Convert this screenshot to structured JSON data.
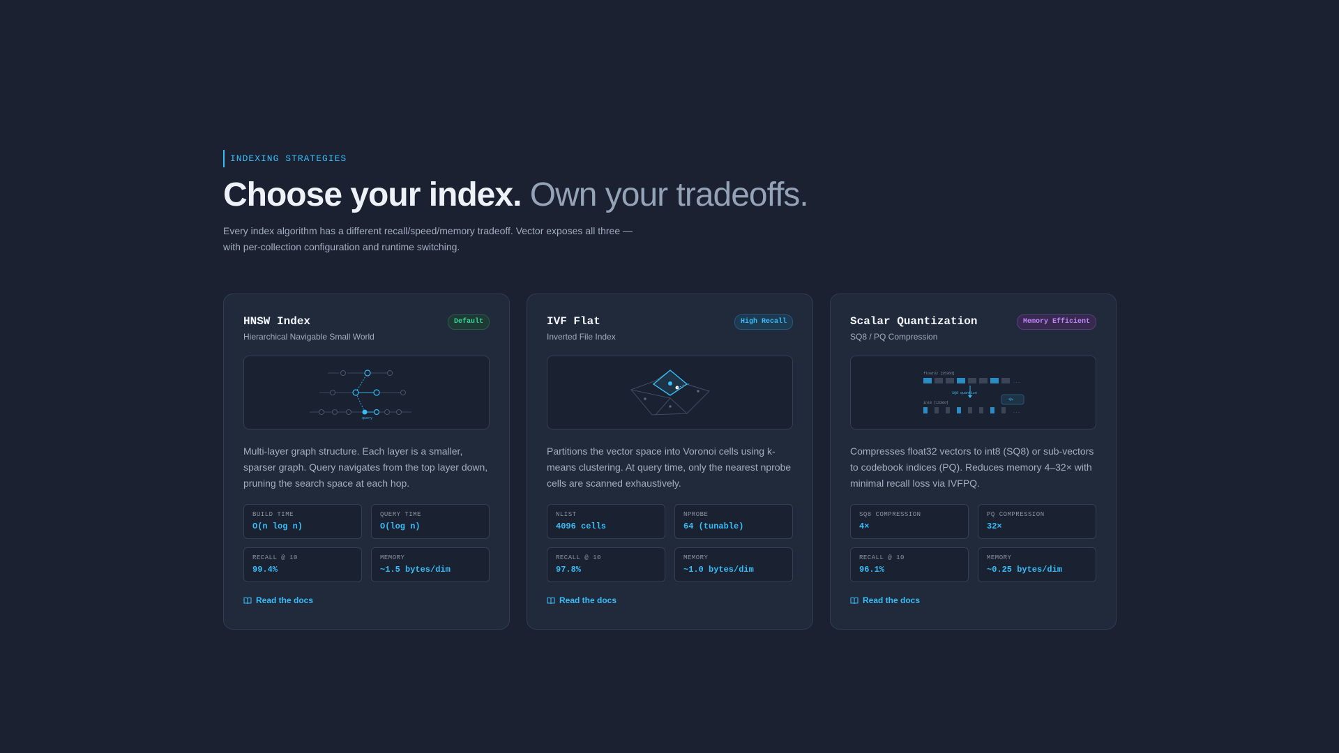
{
  "section": {
    "eyebrow": "INDEXING STRATEGIES",
    "headline_strong": "Choose your index.",
    "headline_soft": "Own your tradeoffs.",
    "lede": "Every index algorithm has a different recall/speed/memory tradeoff. Vector exposes all three — with per-collection configuration and runtime switching."
  },
  "colors": {
    "background": "#1b2131",
    "card": "#212a3b",
    "accent": "#38bdf8",
    "badge_default": "#34d399",
    "badge_high_recall": "#38bdf8",
    "badge_memory": "#c084fc"
  },
  "cards": [
    {
      "title": "HNSW Index",
      "badge": "Default",
      "subtitle": "Hierarchical Navigable Small World",
      "viz_label": "query",
      "description": "Multi-layer graph structure. Each layer is a smaller, sparser graph. Query navigates from the top layer down, pruning the search space at each hop.",
      "stats": [
        {
          "label": "BUILD TIME",
          "value": "O(n log n)"
        },
        {
          "label": "QUERY TIME",
          "value": "O(log n)"
        },
        {
          "label": "RECALL @ 10",
          "value": "99.4%"
        },
        {
          "label": "MEMORY",
          "value": "~1.5 bytes/dim"
        }
      ],
      "docs_label": "Read the docs",
      "docs_icon": "book-icon"
    },
    {
      "title": "IVF Flat",
      "badge": "High Recall",
      "subtitle": "Inverted File Index",
      "description": "Partitions the vector space into Voronoi cells using k-means clustering. At query time, only the nearest nprobe cells are scanned exhaustively.",
      "stats": [
        {
          "label": "NLIST",
          "value": "4096 cells"
        },
        {
          "label": "NPROBE",
          "value": "64 (tunable)"
        },
        {
          "label": "RECALL @ 10",
          "value": "97.8%"
        },
        {
          "label": "MEMORY",
          "value": "~1.0 bytes/dim"
        }
      ],
      "docs_label": "Read the docs",
      "docs_icon": "book-icon"
    },
    {
      "title": "Scalar Quantization",
      "badge": "Memory Efficient",
      "subtitle": "SQ8 / PQ Compression",
      "viz_top_label": "float32 [1536d]",
      "viz_mid_label": "SQ8 quantize",
      "viz_bottom_label": "int8 [1536d]",
      "viz_ratio": "4×",
      "viz_ellipsis": "...",
      "description": "Compresses float32 vectors to int8 (SQ8) or sub-vectors to codebook indices (PQ). Reduces memory 4–32× with minimal recall loss via IVFPQ.",
      "stats": [
        {
          "label": "SQ8 COMPRESSION",
          "value": "4×"
        },
        {
          "label": "PQ COMPRESSION",
          "value": "32×"
        },
        {
          "label": "RECALL @ 10",
          "value": "96.1%"
        },
        {
          "label": "MEMORY",
          "value": "~0.25 bytes/dim"
        }
      ],
      "docs_label": "Read the docs",
      "docs_icon": "book-icon"
    }
  ]
}
